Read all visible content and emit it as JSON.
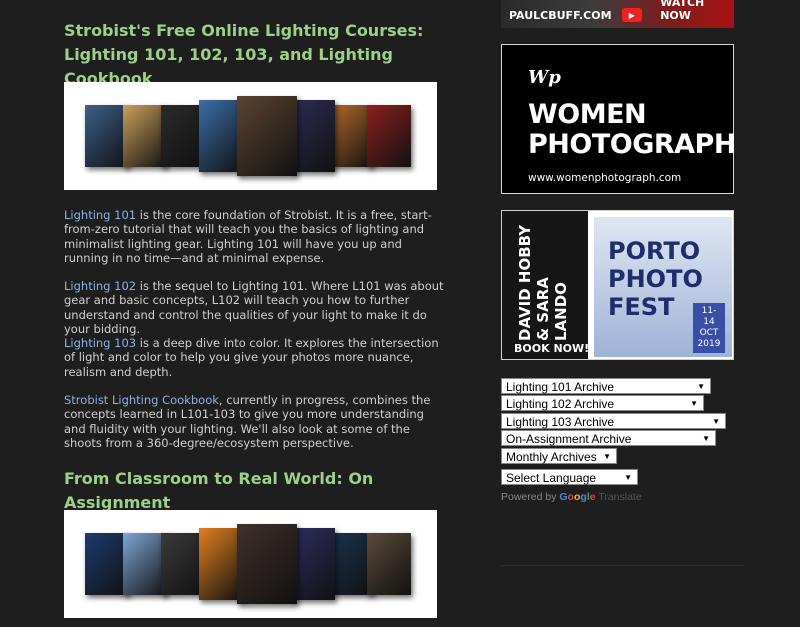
{
  "courses_heading": "Strobist's Free Online Lighting Courses: Lighting 101, 102, 103, and Lighting Cookbook",
  "paragraphs": [
    {
      "link": "Lighting 101",
      "text": " is the core foundation of Strobist. It is a free, start-from-zero tutorial that will teach you the basics of lighting and minimalist lighting gear. Lighting 101 will have you up and running in no time—and at minimal expense."
    },
    {
      "link": "Lighting 102",
      "text": " is the sequel to Lighting 101. Where L101 was about gear and basic concepts, L102 will teach you how to further understand and control the qualities of your light to make it do your bidding."
    },
    {
      "link": "Lighting 103",
      "text": " is a deep dive into color. It explores the intersection of light and color to help you give your photos more nuance, realism and depth."
    },
    {
      "link": "Strobist Lighting Cookbook",
      "text": ", currently in progress, combines the concepts learned in L101-103 to give you more understanding and fluidity with your lighting. We'll also look at some of the shoots from a 360-degree/ecosystem perspective."
    }
  ],
  "assignment_heading": "From Classroom to Real World: On Assignment",
  "banner1_colors": [
    "#3c5f8a",
    "#caa05a",
    "#2a2a2a",
    "#3a6ea8",
    "#5b4430",
    "#2c2c55",
    "#b86a2a",
    "#8c1f1f"
  ],
  "banner2_colors": [
    "#1e3a6e",
    "#7fa6d6",
    "#3a3a3a",
    "#e2801f",
    "#40302a",
    "#2d2d60",
    "#1a3550",
    "#5a4a3a"
  ],
  "ads": {
    "top_text": "PAULCBUFF.COM",
    "top_cta": "WATCH NOW",
    "women_logo": "Wp",
    "women_title": "WOMEN PHOTOGRAPH",
    "women_url": "www.womenphotograph.com",
    "porto_names": "DAVID HOBBY & SARA LANDO",
    "porto_book": "BOOK NOW!",
    "porto_title": "PORTO PHOTO FEST",
    "porto_dates": "11-14 OCT 2019"
  },
  "selects": [
    {
      "label": "Lighting 101 Archive"
    },
    {
      "label": "Lighting 102 Archive"
    },
    {
      "label": "Lighting 103 Archive"
    },
    {
      "label": "On-Assignment Archive"
    },
    {
      "label": "Monthly Archives"
    },
    {
      "label": "Select Language"
    }
  ],
  "powered_by": "Powered by",
  "google": "Google",
  "translate": "Translate"
}
